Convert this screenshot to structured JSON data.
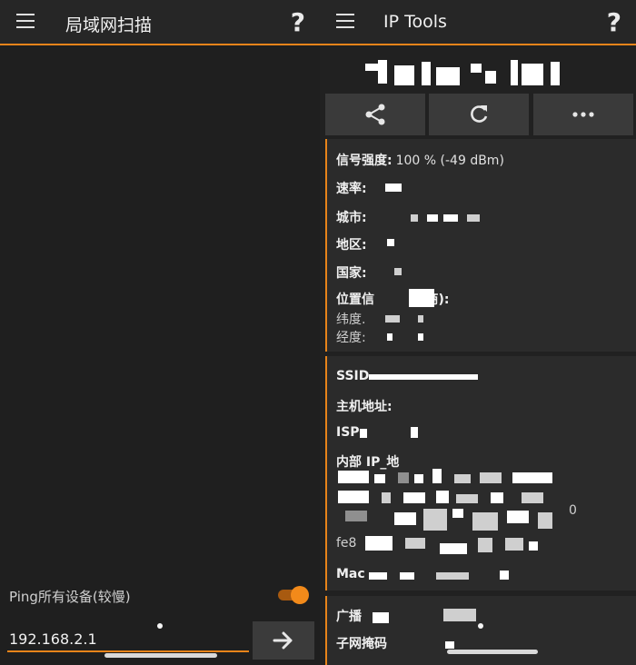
{
  "left": {
    "title": "局域网扫描",
    "help_label": "?",
    "ping_label": "Ping所有设备(较慢)",
    "ping_toggle_on": true,
    "ip_value": "192.168.2.1",
    "go_icon": "arrow-right-icon",
    "accent": "#e8841a"
  },
  "right": {
    "title": "IP Tools",
    "help_label": "?",
    "actions": [
      {
        "icon": "share-icon"
      },
      {
        "icon": "refresh-icon"
      },
      {
        "icon": "more-icon"
      }
    ],
    "network": {
      "signal_label": "信号强度:",
      "signal_value": "100 % (-49 dBm)",
      "speed_label": "速率:",
      "city_label": "城市:",
      "region_label": "地区:",
      "country_label": "国家:",
      "location_label": "位置信",
      "location_suffix": "商):",
      "lat_label": "纬度.",
      "lon_label": "经度:"
    },
    "wifi": {
      "ssid_label": "SSID",
      "host_label": "主机地址:",
      "isp_label": "ISP",
      "internal_ip_label": "内部 IP_地",
      "ipv6_fragment": "fe8",
      "trailing_digit": "0",
      "mac_label": "Mac"
    },
    "bottom": {
      "broadcast_label": "广播",
      "subnet_label": "子网掩码"
    }
  }
}
